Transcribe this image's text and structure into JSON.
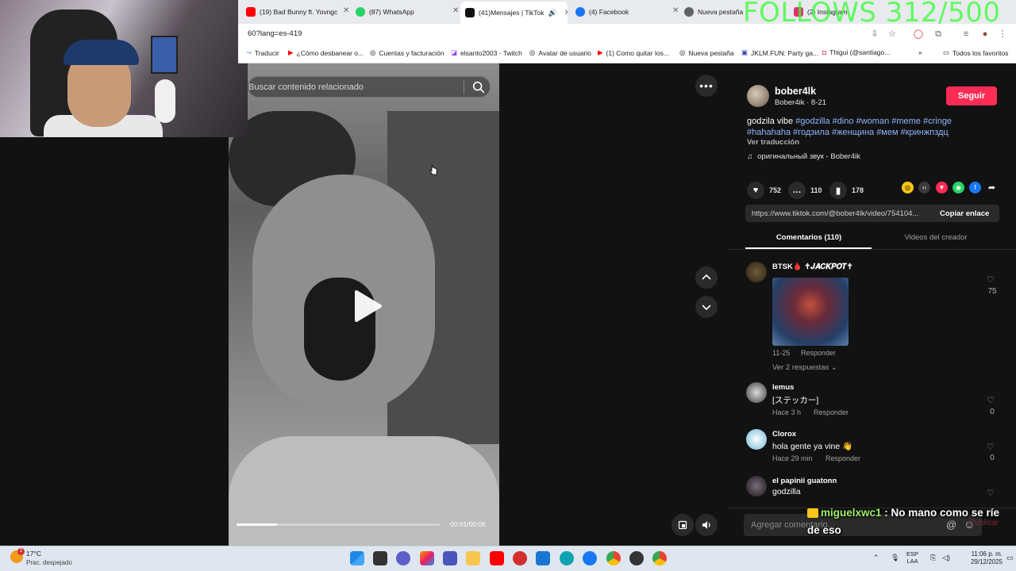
{
  "overlay": {
    "follows_text": "FOLLOWS 312/500"
  },
  "browser": {
    "tabs": [
      {
        "label": "(19) Bad Bunny ft. Yovngc",
        "color": "#ff0000"
      },
      {
        "label": "(87) WhatsApp",
        "color": "#25d366"
      },
      {
        "label": "(41)Mensajes | TikTok",
        "color": "#111111",
        "active": true
      },
      {
        "label": "(4) Facebook",
        "color": "#1877f2"
      },
      {
        "label": "Nueva pestaña",
        "color": "#5f6368"
      },
      {
        "label": "(2) Instagram",
        "color": "#e1306c"
      }
    ],
    "url": "60?lang=es-419",
    "bookmarks": [
      "Traducir",
      "¿Cómo desbanear o...",
      "Cuentas y facturación",
      "elsanto2003 - Twitch",
      "Avatar de usuario",
      "(1) Como quitar los...",
      "Nueva pestaña",
      "JKLM.FUN: Party ga...",
      "Thigui (@santiago...",
      "Todos los favoritos"
    ]
  },
  "video": {
    "search_placeholder": "Buscar contenido relacionado",
    "time": "00:01/00:06",
    "progress": 0.2
  },
  "post": {
    "username": "bober4lk",
    "subline": "Bober4ik · 8-21",
    "follow_label": "Seguir",
    "caption_text": "godzila vibe ",
    "caption_tags": "#godzilla #dino #woman #meme #cringe #hahahaha #годзила #женщина #мем #кринжпздц",
    "translate": "Ver traducción",
    "sound": "оригинальный звук - Bober4ik",
    "likes": "752",
    "comments": "110",
    "saves": "178",
    "link": "https://www.tiktok.com/@bober4lk/video/754104...",
    "copy_label": "Copiar enlace",
    "tab_comments": "Comentarios (110)",
    "tab_videos": "Videos del creador"
  },
  "comments": [
    {
      "name": "BTSK🩸 ✝𝑱𝑨𝑪𝑲𝑷𝑶𝑻✝",
      "text": "",
      "date": "11-25",
      "reply": "Responder",
      "likes": "75",
      "replies": "Ver 2 respuestas ⌄"
    },
    {
      "name": "lemus",
      "text": "[ステッカー]",
      "date": "Hace 3 h",
      "reply": "Responder",
      "likes": "0"
    },
    {
      "name": "Clorox",
      "text": "hola gente ya vine 👋",
      "date": "Hace 29 min",
      "reply": "Responder",
      "likes": "0"
    },
    {
      "name": "el papinii guatonn",
      "text": "godzilla"
    }
  ],
  "comment_box": {
    "placeholder": "Agregar comentario...",
    "publish": "Publicar"
  },
  "chat": {
    "user": "miguelxwc1",
    "message": " : No mano como se ríe de eso"
  },
  "taskbar": {
    "temp": "17°C",
    "weather": "Prac. despejado",
    "weather_badge": "2",
    "lang": "ESP",
    "lang2": "LAA",
    "time": "11:06 p. m.",
    "date": "29/12/2025"
  }
}
